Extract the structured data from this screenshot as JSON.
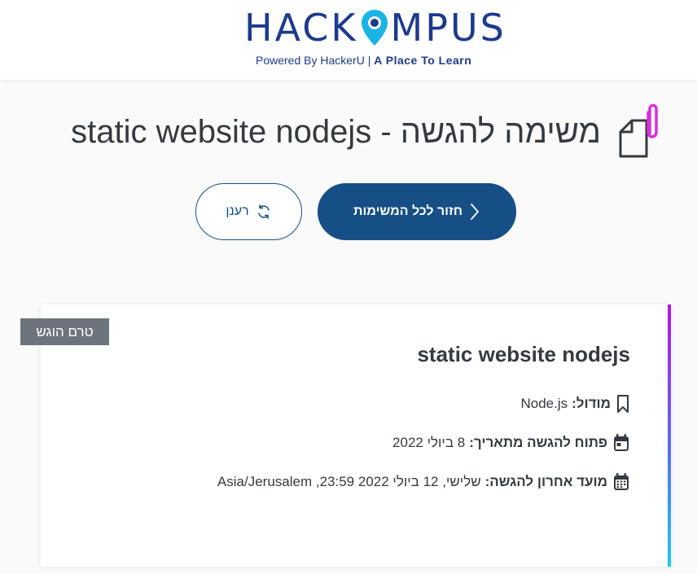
{
  "header": {
    "logo_main_left": "HACK",
    "logo_main_right": "MPUS",
    "logo_sub_left": "Powered By HackerU |",
    "logo_sub_right": "A Place To Learn"
  },
  "page": {
    "title": "משימה להגשה - static website nodejs",
    "icon": "paperclip-document-icon"
  },
  "buttons": {
    "back_label": "חזור לכל המשימות",
    "back_icon": "chevron-right-icon",
    "refresh_label": "רענן",
    "refresh_icon": "refresh-icon"
  },
  "task": {
    "status": "טרם הוגש",
    "title": "static website nodejs",
    "module_label": "מודול:",
    "module_value": "Node.js",
    "open_label": "פתוח להגשה מתאריך:",
    "open_value": "8 ביולי 2022",
    "deadline_label": "מועד אחרון להגשה:",
    "deadline_value": "שלישי, 12 ביולי 2022 23:59, Asia/Jerusalem"
  },
  "colors": {
    "primary": "#164f86",
    "logo": "#1d3b8c",
    "pin": "#1ab3e6",
    "badge": "#6c757d",
    "accent_top": "#b414e4",
    "accent_bottom": "#1ec9ef"
  }
}
